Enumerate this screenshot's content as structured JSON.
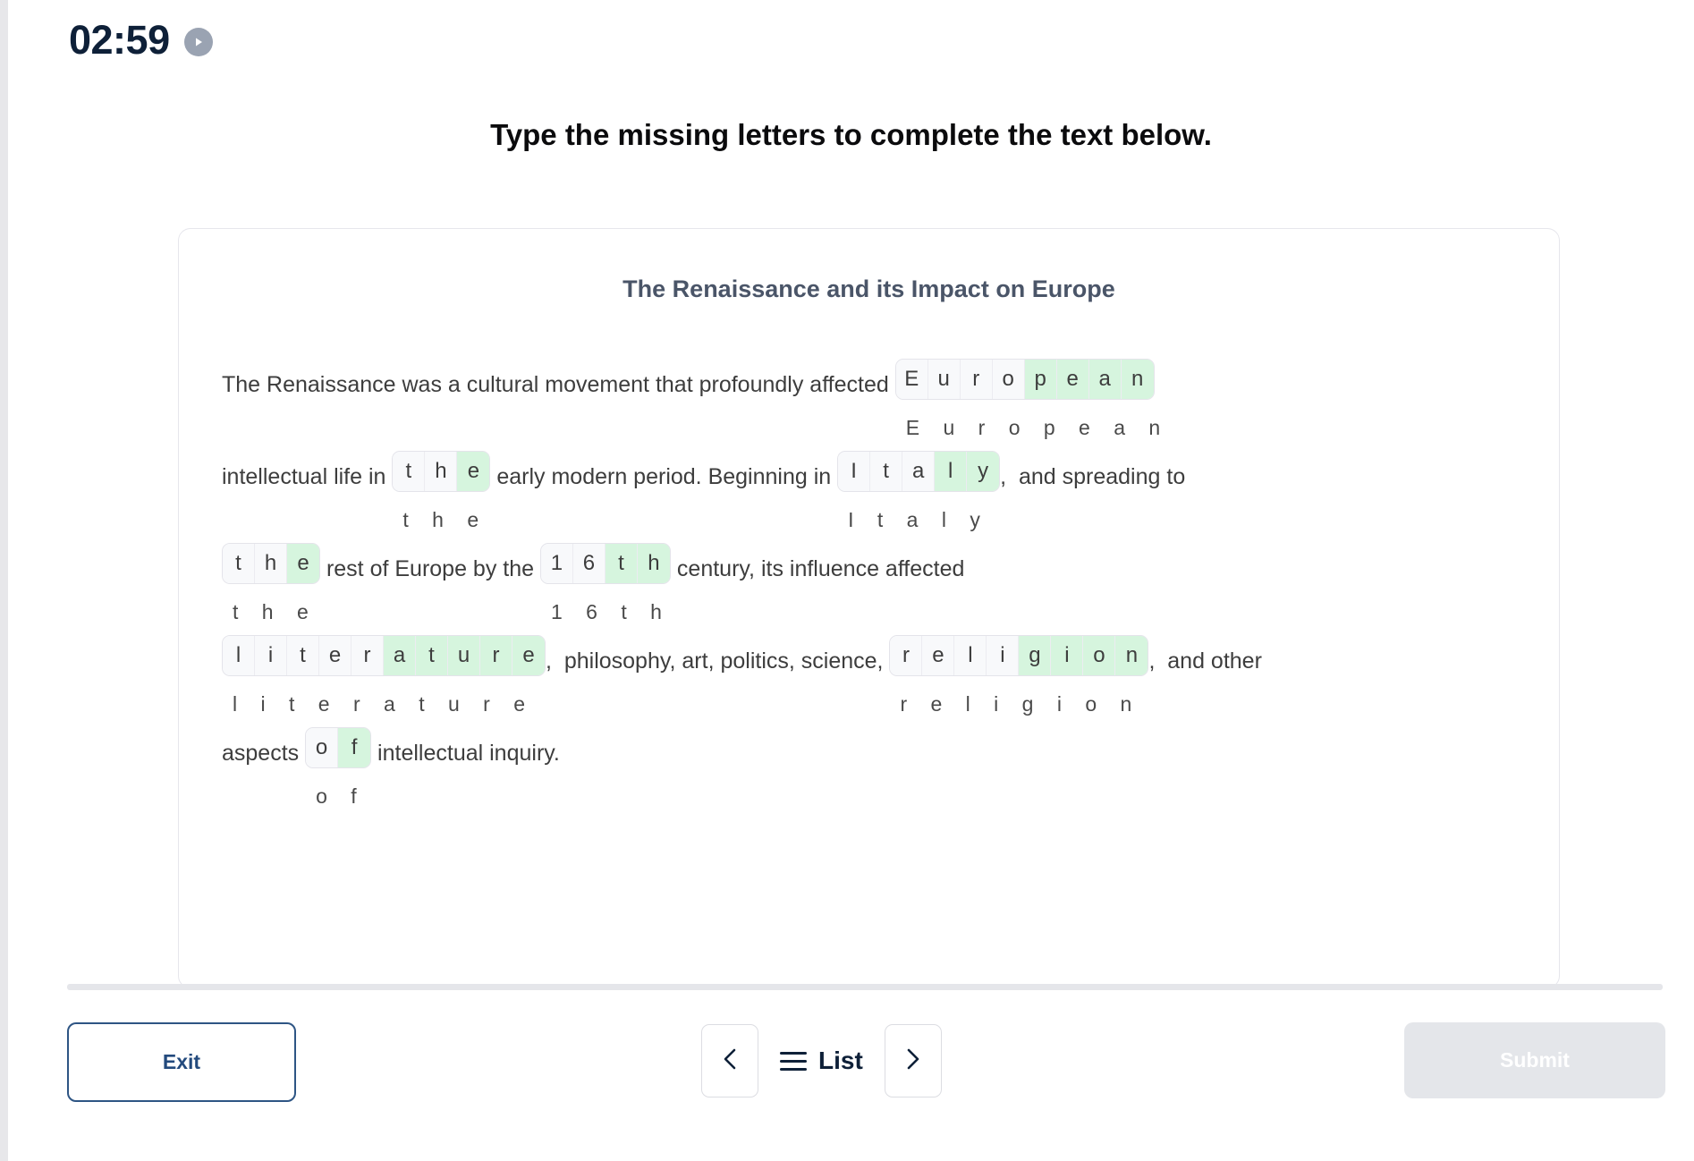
{
  "timer": {
    "value": "02:59",
    "play_icon": "play-circle-icon"
  },
  "prompt": "Type the missing letters to complete the text below.",
  "card": {
    "title": "The Renaissance and its Impact on Europe",
    "lines": [
      {
        "segments": [
          {
            "kind": "text",
            "text": "The Renaissance was a cultural movement that profoundly affected "
          },
          {
            "kind": "word",
            "hint": "E u r o p e a n",
            "cells": [
              {
                "ch": "E",
                "filled": false
              },
              {
                "ch": "u",
                "filled": false
              },
              {
                "ch": "r",
                "filled": false
              },
              {
                "ch": "o",
                "filled": false
              },
              {
                "ch": "p",
                "filled": true
              },
              {
                "ch": "e",
                "filled": true
              },
              {
                "ch": "a",
                "filled": true
              },
              {
                "ch": "n",
                "filled": true
              }
            ]
          }
        ]
      },
      {
        "segments": [
          {
            "kind": "text",
            "text": "intellectual life in "
          },
          {
            "kind": "word",
            "hint": "t h e",
            "cells": [
              {
                "ch": "t",
                "filled": false
              },
              {
                "ch": "h",
                "filled": false
              },
              {
                "ch": "e",
                "filled": true
              }
            ]
          },
          {
            "kind": "text",
            "text": " early modern period. Beginning in "
          },
          {
            "kind": "word",
            "hint": "I t a l y",
            "cells": [
              {
                "ch": "I",
                "filled": false
              },
              {
                "ch": "t",
                "filled": false
              },
              {
                "ch": "a",
                "filled": false
              },
              {
                "ch": "l",
                "filled": true
              },
              {
                "ch": "y",
                "filled": true
              }
            ]
          },
          {
            "kind": "punct",
            "text": ",  and spreading to"
          }
        ]
      },
      {
        "segments": [
          {
            "kind": "word",
            "hint": "t h e",
            "cells": [
              {
                "ch": "t",
                "filled": false
              },
              {
                "ch": "h",
                "filled": false
              },
              {
                "ch": "e",
                "filled": true
              }
            ]
          },
          {
            "kind": "text",
            "text": " rest of Europe by the "
          },
          {
            "kind": "word",
            "hint": "1 6 t h",
            "cells": [
              {
                "ch": "1",
                "filled": false
              },
              {
                "ch": "6",
                "filled": false
              },
              {
                "ch": "t",
                "filled": true
              },
              {
                "ch": "h",
                "filled": true
              }
            ]
          },
          {
            "kind": "text",
            "text": " century, its influence affected"
          }
        ]
      },
      {
        "segments": [
          {
            "kind": "word",
            "hint": "l i t e r a t u r e",
            "cells": [
              {
                "ch": "l",
                "filled": false
              },
              {
                "ch": "i",
                "filled": false
              },
              {
                "ch": "t",
                "filled": false
              },
              {
                "ch": "e",
                "filled": false
              },
              {
                "ch": "r",
                "filled": false
              },
              {
                "ch": "a",
                "filled": true
              },
              {
                "ch": "t",
                "filled": true
              },
              {
                "ch": "u",
                "filled": true
              },
              {
                "ch": "r",
                "filled": true
              },
              {
                "ch": "e",
                "filled": true
              }
            ]
          },
          {
            "kind": "punct",
            "text": ",  philosophy, art, politics, science, "
          },
          {
            "kind": "word",
            "hint": "r e l i g i o n",
            "cells": [
              {
                "ch": "r",
                "filled": false
              },
              {
                "ch": "e",
                "filled": false
              },
              {
                "ch": "l",
                "filled": false
              },
              {
                "ch": "i",
                "filled": false
              },
              {
                "ch": "g",
                "filled": true
              },
              {
                "ch": "i",
                "filled": true
              },
              {
                "ch": "o",
                "filled": true
              },
              {
                "ch": "n",
                "filled": true
              }
            ]
          },
          {
            "kind": "punct",
            "text": ",  and other"
          }
        ]
      },
      {
        "segments": [
          {
            "kind": "text",
            "text": "aspects "
          },
          {
            "kind": "word",
            "hint": "o f",
            "cells": [
              {
                "ch": "o",
                "filled": false
              },
              {
                "ch": "f",
                "filled": true
              }
            ]
          },
          {
            "kind": "text",
            "text": " intellectual inquiry."
          }
        ]
      }
    ]
  },
  "footer": {
    "exit_label": "Exit",
    "prev_icon": "chevron-left-icon",
    "list_label": "List",
    "list_icon": "hamburger-icon",
    "next_icon": "chevron-right-icon",
    "submit_label": "Submit"
  },
  "colors": {
    "accent_navy": "#234a7d",
    "filled_cell": "#d6f5de",
    "empty_cell": "#f8f9fb",
    "card_title": "#4a5568",
    "submit_disabled_bg": "#e4e6ea"
  }
}
